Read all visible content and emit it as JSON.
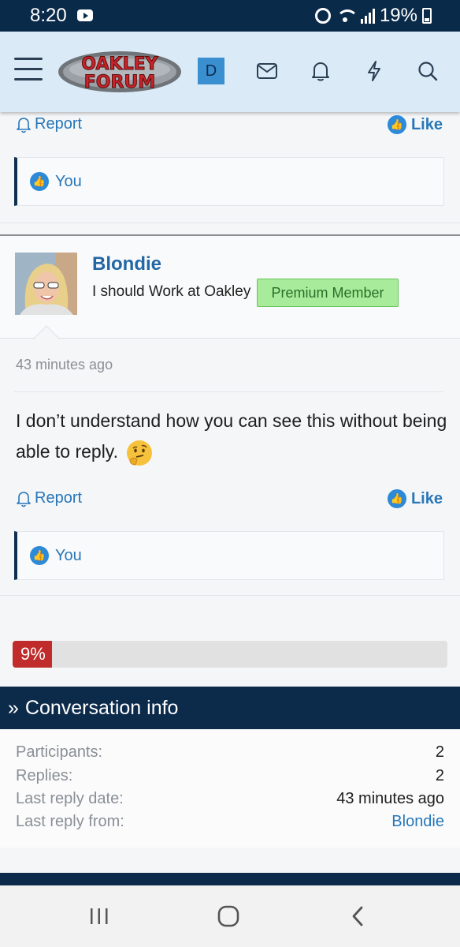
{
  "status_bar": {
    "time": "8:20",
    "battery": "19%"
  },
  "header": {
    "logo_line1": "OAKLEY",
    "logo_line2": "FORUM",
    "avatar_letter": "D"
  },
  "first_post_actions": {
    "report_label": "Report",
    "like_label": "Like",
    "reactions_text": "You"
  },
  "post": {
    "username": "Blondie",
    "user_title": "I should Work at Oakley",
    "badge": "Premium Member",
    "time_ago": "43 minutes ago",
    "body": "I don’t understand how you can see this without being able to reply.",
    "report_label": "Report",
    "like_label": "Like",
    "reactions_text": "You"
  },
  "progress": {
    "label": "9%",
    "value": 9
  },
  "conversation_info": {
    "title": "Conversation info",
    "rows": [
      {
        "key": "Participants:",
        "value": "2"
      },
      {
        "key": "Replies:",
        "value": "2"
      },
      {
        "key": "Last reply date:",
        "value": "43 minutes ago"
      },
      {
        "key": "Last reply from:",
        "value": "Blondie"
      }
    ]
  },
  "colors": {
    "header_bg": "#dbeaf7",
    "navy": "#0c2b4b",
    "link": "#2877b8",
    "badge_bg": "#a8ec9b",
    "progress": "#c02b2b"
  }
}
